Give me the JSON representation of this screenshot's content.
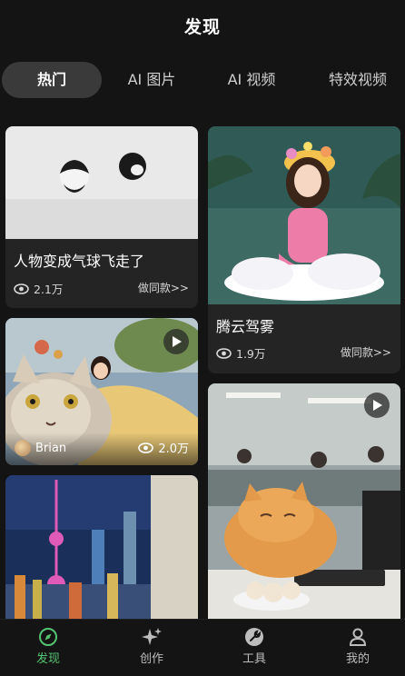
{
  "header": {
    "title": "发现"
  },
  "tabs": [
    {
      "label": "热门",
      "active": true
    },
    {
      "label": "AI 图片",
      "active": false
    },
    {
      "label": "AI 视频",
      "active": false
    },
    {
      "label": "特效视频",
      "active": false
    }
  ],
  "cards": [
    {
      "title": "人物变成气球飞走了",
      "views": "2.1万",
      "make_label": "做同款>>"
    },
    {
      "title": "腾云驾雾",
      "views": "1.9万",
      "make_label": "做同款>>"
    },
    {
      "author": "Brian",
      "views": "2.0万",
      "has_play": true
    },
    {
      "has_play": true
    },
    {}
  ],
  "bottom_nav": [
    {
      "label": "发现",
      "icon": "compass-icon",
      "active": true
    },
    {
      "label": "创作",
      "icon": "sparkle-icon",
      "active": false
    },
    {
      "label": "工具",
      "icon": "wrench-icon",
      "active": false
    },
    {
      "label": "我的",
      "icon": "user-icon",
      "active": false
    }
  ],
  "colors": {
    "accent": "#55c472",
    "background": "#141414",
    "card": "#242424",
    "tab_active": "#3a3a3a"
  }
}
